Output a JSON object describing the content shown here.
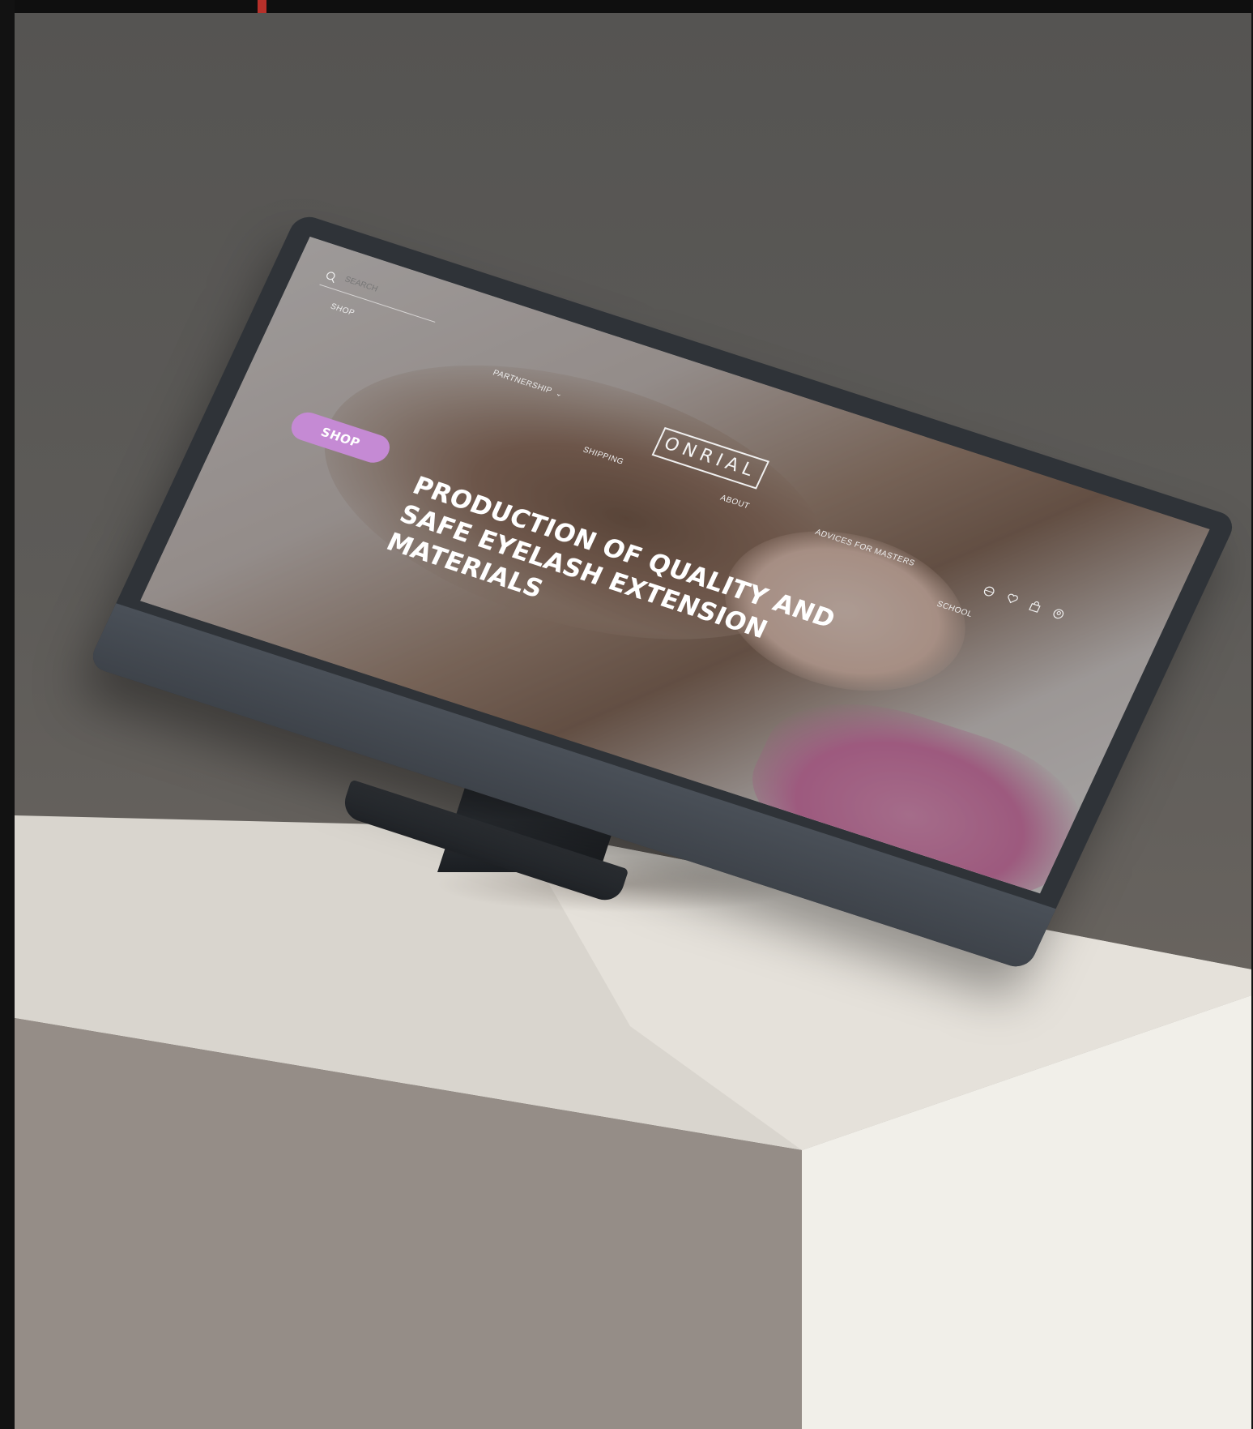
{
  "website": {
    "search": {
      "placeholder": "SEARCH"
    },
    "nav": {
      "shop": "SHOP",
      "partnership": "PARTNERSHIP",
      "shipping": "SHIPPING",
      "about": "ABOUT",
      "advices": "ADVICES FOR MASTERS",
      "school": "SCHOOL"
    },
    "logo": "ONRIAL",
    "hero": {
      "cta": "SHOP",
      "headline": "PRODUCTION OF QUALITY AND SAFE EYELASH EXTENSION MATERIALS"
    },
    "header_icons": [
      "language-icon",
      "favorites-icon",
      "cart-icon",
      "account-icon"
    ],
    "colors": {
      "cta": "#c58ad4",
      "text": "#ffffff",
      "accent_mark": "#b7302a"
    }
  }
}
